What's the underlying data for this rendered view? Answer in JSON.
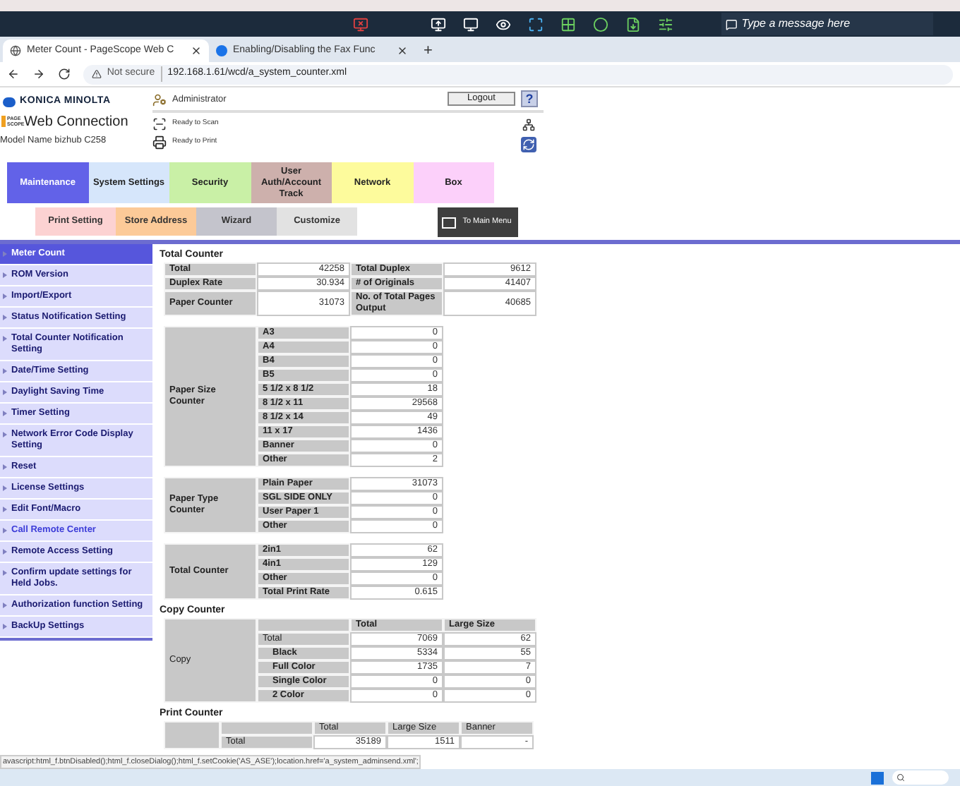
{
  "remote_toolbar": {
    "message_placeholder": "Type a message here"
  },
  "browser": {
    "tabs": [
      {
        "title": "Meter Count - PageScope Web C",
        "selected": true
      },
      {
        "title": "Enabling/Disabling the Fax Func",
        "selected": false
      }
    ],
    "new_tab": "+",
    "security": "Not secure",
    "url": "192.168.1.61/wcd/a_system_counter.xml"
  },
  "header": {
    "brand": "KONICA MINOLTA",
    "product_badge": "PAGE SCOPE",
    "product": "Web Connection",
    "model": "Model Name bizhub C258",
    "user": "Administrator",
    "logout": "Logout",
    "help": "?",
    "statuses": [
      "Ready to Scan",
      "Ready to Print"
    ]
  },
  "tabs": [
    {
      "label": "Maintenance",
      "selected": true,
      "color": "#6262e8"
    },
    {
      "label": "System Settings",
      "selected": false,
      "color": "#d6e6fb"
    },
    {
      "label": "Security",
      "selected": false,
      "color": "#c9f0a6"
    },
    {
      "label": "User Auth/Account Track",
      "selected": false,
      "color": "#cdb0ac"
    },
    {
      "label": "Network",
      "selected": false,
      "color": "#fdfb9c"
    },
    {
      "label": "Box",
      "selected": false,
      "color": "#fcd0fa"
    }
  ],
  "subtabs": [
    {
      "label": "Print Setting",
      "color": "#fcd2d2"
    },
    {
      "label": "Store Address",
      "color": "#fcca98"
    },
    {
      "label": "Wizard",
      "color": "#c4c4cc"
    },
    {
      "label": "Customize",
      "color": "#e2e2e2"
    }
  ],
  "main_menu": "To Main Menu",
  "sidebar": [
    {
      "label": "Meter Count",
      "selected": true,
      "hovered": false
    },
    {
      "label": "ROM Version",
      "selected": false,
      "hovered": false
    },
    {
      "label": "Import/Export",
      "selected": false,
      "hovered": false
    },
    {
      "label": "Status Notification Setting",
      "selected": false,
      "hovered": false
    },
    {
      "label": "Total Counter Notification Setting",
      "selected": false,
      "hovered": false
    },
    {
      "label": "Date/Time Setting",
      "selected": false,
      "hovered": false
    },
    {
      "label": "Daylight Saving Time",
      "selected": false,
      "hovered": false
    },
    {
      "label": "Timer Setting",
      "selected": false,
      "hovered": false
    },
    {
      "label": "Network Error Code Display Setting",
      "selected": false,
      "hovered": false
    },
    {
      "label": "Reset",
      "selected": false,
      "hovered": false
    },
    {
      "label": "License Settings",
      "selected": false,
      "hovered": false
    },
    {
      "label": "Edit Font/Macro",
      "selected": false,
      "hovered": false
    },
    {
      "label": "Call Remote Center",
      "selected": false,
      "hovered": true
    },
    {
      "label": "Remote Access Setting",
      "selected": false,
      "hovered": false
    },
    {
      "label": "Confirm update settings for Held Jobs.",
      "selected": false,
      "hovered": false
    },
    {
      "label": "Authorization function Setting",
      "selected": false,
      "hovered": false
    },
    {
      "label": "BackUp Settings",
      "selected": false,
      "hovered": false
    }
  ],
  "total_counter": {
    "title": "Total Counter",
    "rows": [
      [
        "Total",
        "42258",
        "Total Duplex",
        "9612"
      ],
      [
        "Duplex Rate",
        "30.934",
        "# of Originals",
        "41407"
      ],
      [
        "Paper Counter",
        "31073",
        "No. of Total Pages Output",
        "40685"
      ]
    ]
  },
  "groups": [
    {
      "label": "Paper Size Counter",
      "rows": [
        [
          "A3",
          "0"
        ],
        [
          "A4",
          "0"
        ],
        [
          "B4",
          "0"
        ],
        [
          "B5",
          "0"
        ],
        [
          "5 1/2 x 8 1/2",
          "18"
        ],
        [
          "8 1/2 x 11",
          "29568"
        ],
        [
          "8 1/2 x 14",
          "49"
        ],
        [
          "11 x 17",
          "1436"
        ],
        [
          "Banner",
          "0"
        ],
        [
          "Other",
          "2"
        ]
      ]
    },
    {
      "label": "Paper Type Counter",
      "rows": [
        [
          "Plain Paper",
          "31073"
        ],
        [
          "SGL SIDE ONLY",
          "0"
        ],
        [
          "User Paper 1",
          "0"
        ],
        [
          "Other",
          "0"
        ]
      ]
    },
    {
      "label": "Total Counter",
      "rows": [
        [
          "2in1",
          "62"
        ],
        [
          "4in1",
          "129"
        ],
        [
          "Other",
          "0"
        ],
        [
          "Total Print Rate",
          "0.615"
        ]
      ]
    }
  ],
  "copy_counter": {
    "title": "Copy Counter",
    "label": "Copy",
    "columns": [
      "Total",
      "Large Size"
    ],
    "rows": [
      {
        "item": "Total",
        "values": [
          "7069",
          "62"
        ],
        "children": [
          {
            "item": "Black",
            "values": [
              "5334",
              "55"
            ]
          },
          {
            "item": "Full Color",
            "values": [
              "1735",
              "7"
            ]
          },
          {
            "item": "Single Color",
            "values": [
              "0",
              "0"
            ]
          },
          {
            "item": "2 Color",
            "values": [
              "0",
              "0"
            ]
          }
        ]
      }
    ]
  },
  "print_counter": {
    "title": "Print Counter",
    "columns": [
      "Total",
      "Large Size",
      "Banner"
    ],
    "rows": [
      {
        "item": "Total",
        "values": [
          "35189",
          "1511",
          "-"
        ]
      }
    ]
  },
  "status_url": "avascript:html_f.btnDisabled();html_f.closeDialog();html_f.setCookie('AS_ASE');location.href='a_system_adminsend.xml';"
}
